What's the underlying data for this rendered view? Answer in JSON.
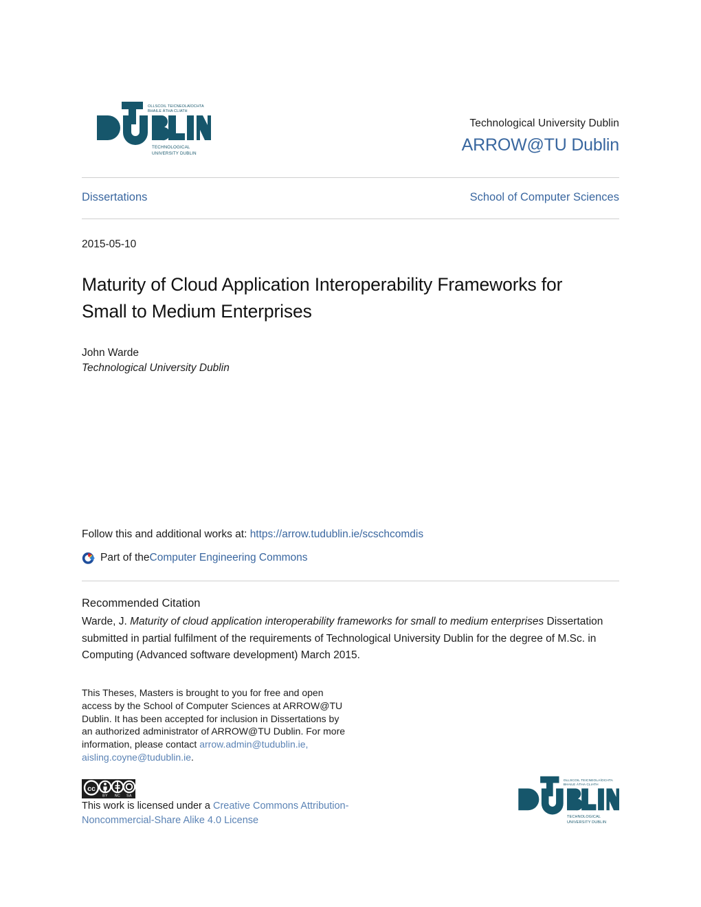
{
  "masthead": {
    "logo_alt": "TU Dublin logo",
    "logo_wordmark": "DUBLIN",
    "logo_irish_line1": "OLLSCOIL TEICNEOLAÍOCHTA",
    "logo_irish_line2": "BHAILE ÁTHA CLIATH",
    "logo_sub_line1": "TECHNOLOGICAL",
    "logo_sub_line2": "UNIVERSITY DUBLIN",
    "university": "Technological University Dublin",
    "repository": "ARROW@TU Dublin"
  },
  "nav": {
    "collection": "Dissertations",
    "school": "School of Computer Sciences"
  },
  "article": {
    "date": "2015-05-10",
    "title": "Maturity of Cloud Application Interoperability Frameworks for Small to Medium Enterprises",
    "author": "John Warde",
    "affiliation": "Technological University Dublin"
  },
  "follow": {
    "prefix": "Follow this and additional works at: ",
    "url_text": "https://arrow.tudublin.ie/scschcomdis",
    "part_of_prefix": "Part of the ",
    "commons_link": "Computer Engineering Commons",
    "dc_icon": "digital-commons-icon"
  },
  "citation": {
    "heading": "Recommended Citation",
    "author_prefix": "Warde, J. ",
    "title_italic": "Maturity of cloud application interoperability frameworks for small to medium enterprises",
    "rest": " Dissertation submitted in partial fulfilment of the requirements of Technological University Dublin for the degree of M.Sc. in Computing (Advanced software development) March 2015."
  },
  "footnote": {
    "text_1": "This Theses, Masters is brought to you for free and open access by the School of Computer Sciences at ARROW@TU Dublin. It has been accepted for inclusion in Dissertations by an authorized administrator of ARROW@TU Dublin. For more information, please contact ",
    "email_1": "arrow.admin@tudublin.ie,",
    "email_2": "aisling.coyne@tudublin.ie",
    "text_2": "."
  },
  "license": {
    "badge_alt": "Creative Commons BY-NC-SA badge",
    "badge_cc": "CC",
    "badge_by": "BY",
    "badge_nc": "NC",
    "badge_sa": "SA",
    "prefix": "This work is licensed under a ",
    "link": "Creative Commons Attribution-Noncommercial-Share Alike 4.0 License"
  },
  "colors": {
    "logo_teal": "#16566b",
    "link_blue": "#3a67a0",
    "muted_link_blue": "#5b83b5",
    "rule_grey": "#cfcfcf"
  }
}
